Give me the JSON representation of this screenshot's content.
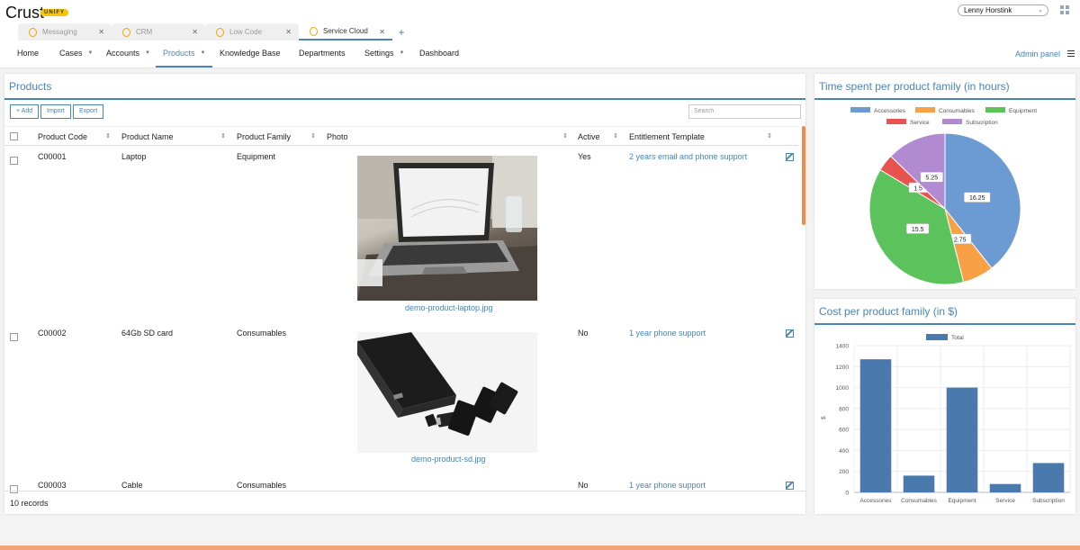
{
  "app": {
    "logo": "Crust",
    "badge": "UNIFY",
    "user": "Lenny Horstink"
  },
  "tabs": [
    {
      "label": "Messaging",
      "active": false
    },
    {
      "label": "CRM",
      "active": false
    },
    {
      "label": "Low Code",
      "active": false
    },
    {
      "label": "Service Cloud",
      "active": true
    }
  ],
  "nav": {
    "items": [
      {
        "label": "Home"
      },
      {
        "label": "Cases"
      },
      {
        "label": "Accounts"
      },
      {
        "label": "Products"
      },
      {
        "label": "Knowledge Base"
      },
      {
        "label": "Departments"
      },
      {
        "label": "Settings"
      },
      {
        "label": "Dashboard"
      }
    ],
    "admin": "Admin panel"
  },
  "products": {
    "title": "Products",
    "buttons": {
      "add": "+ Add",
      "import": "Import",
      "export": "Export"
    },
    "search_placeholder": "Search",
    "columns": [
      "Product Code",
      "Product Name",
      "Product Family",
      "Photo",
      "Active",
      "Entitlement Template"
    ],
    "rows": [
      {
        "code": "C00001",
        "name": "Laptop",
        "family": "Equipment",
        "photo": "demo-product-laptop.jpg",
        "active": "Yes",
        "template": "2 years email and phone support"
      },
      {
        "code": "C00002",
        "name": "64Gb SD card",
        "family": "Consumables",
        "photo": "demo-product-sd.jpg",
        "active": "No",
        "template": "1 year phone support"
      },
      {
        "code": "C00003",
        "name": "Cable",
        "family": "Consumables",
        "photo": "",
        "active": "No",
        "template": "1 year phone support"
      }
    ],
    "records": "10 records"
  },
  "pie_chart": {
    "title": "Time spent per product family (in hours)",
    "chart_data": {
      "type": "pie",
      "legend": [
        "Accessories",
        "Consumables",
        "Equipment",
        "Service",
        "Subscription"
      ],
      "values": [
        16.25,
        2.75,
        15.5,
        1.5,
        5.25
      ],
      "colors": [
        "#6b9bd2",
        "#f7a144",
        "#5cc35c",
        "#e8524f",
        "#b18ad2"
      ],
      "labels": [
        "16.25",
        "2.75",
        "15.5",
        "1.5",
        "5.25"
      ]
    }
  },
  "bar_chart": {
    "title": "Cost per product family (in $)",
    "chart_data": {
      "type": "bar",
      "categories": [
        "Accessories",
        "Consumables",
        "Equipment",
        "Service",
        "Subscription"
      ],
      "series": [
        {
          "name": "Total",
          "values": [
            1270,
            160,
            1000,
            80,
            280
          ],
          "color": "#4a7aad"
        }
      ],
      "ylabel": "$",
      "ylim": [
        0,
        1400
      ],
      "yticks": [
        "0",
        "200",
        "400",
        "600",
        "800",
        "1000",
        "1200",
        "1400"
      ]
    }
  }
}
